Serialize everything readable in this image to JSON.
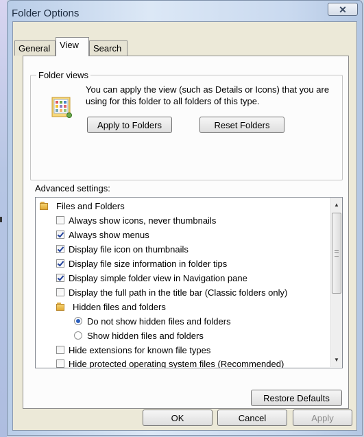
{
  "window": {
    "title": "Folder Options",
    "close_glyph": "✕"
  },
  "tabs": [
    {
      "label": "General",
      "active": false
    },
    {
      "label": "View",
      "active": true
    },
    {
      "label": "Search",
      "active": false
    }
  ],
  "folder_views": {
    "legend": "Folder views",
    "icon": "folder-view-icon",
    "description": "You can apply the view (such as Details or Icons) that you are using for this folder to all folders of this type.",
    "apply_label": "Apply to Folders",
    "reset_label": "Reset Folders"
  },
  "advanced": {
    "label": "Advanced settings:",
    "items": [
      {
        "type": "folder",
        "label": "Files and Folders"
      },
      {
        "type": "checkbox",
        "checked": false,
        "label": "Always show icons, never thumbnails"
      },
      {
        "type": "checkbox",
        "checked": true,
        "label": "Always show menus"
      },
      {
        "type": "checkbox",
        "checked": true,
        "label": "Display file icon on thumbnails"
      },
      {
        "type": "checkbox",
        "checked": true,
        "label": "Display file size information in folder tips"
      },
      {
        "type": "checkbox",
        "checked": true,
        "label": "Display simple folder view in Navigation pane"
      },
      {
        "type": "checkbox",
        "checked": false,
        "label": "Display the full path in the title bar (Classic folders only)"
      },
      {
        "type": "folder",
        "label": "Hidden files and folders"
      },
      {
        "type": "radio",
        "selected": true,
        "label": "Do not show hidden files and folders"
      },
      {
        "type": "radio",
        "selected": false,
        "label": "Show hidden files and folders"
      },
      {
        "type": "checkbox",
        "checked": false,
        "label": "Hide extensions for known file types"
      },
      {
        "type": "checkbox",
        "checked": false,
        "label": "Hide protected operating system files (Recommended)"
      }
    ],
    "restore_label": "Restore Defaults"
  },
  "footer": {
    "ok_label": "OK",
    "cancel_label": "Cancel",
    "apply_label": "Apply"
  },
  "colors": {
    "accent": "#2a5ebd",
    "check": "#21419c",
    "folder": "#e2aa33"
  }
}
